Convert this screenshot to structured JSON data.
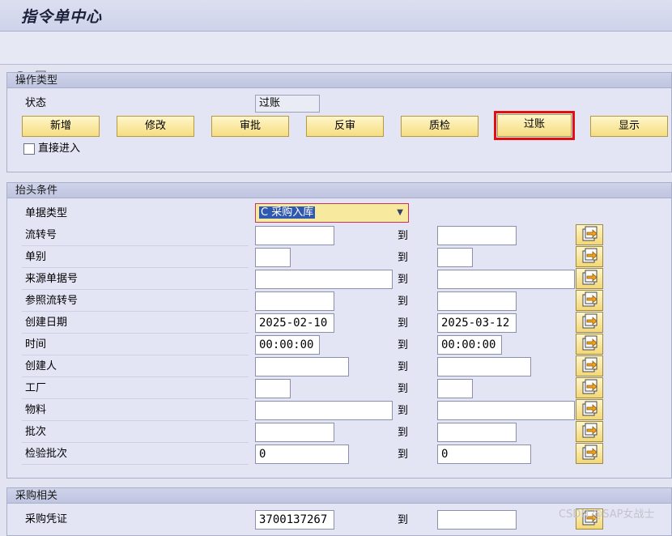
{
  "window": {
    "title": "指令单中心"
  },
  "toolbar": {
    "icons": [
      "execute-icon",
      "copy-icon"
    ]
  },
  "operation_group": {
    "header": "操作类型",
    "status_label": "状态",
    "status_value": "过账",
    "buttons": [
      "新增",
      "修改",
      "审批",
      "反审",
      "质检",
      "过账",
      "显示"
    ],
    "direct_entry_label": "直接进入",
    "direct_entry_checked": false
  },
  "header_group": {
    "header": "抬头条件",
    "doc_type_label": "单据类型",
    "doc_type_value": "C 采购入库",
    "to_label": "到",
    "rows": [
      {
        "label": "流转号",
        "from": "",
        "to": ""
      },
      {
        "label": "单别",
        "from": "",
        "to": ""
      },
      {
        "label": "来源单据号",
        "from": "",
        "to": ""
      },
      {
        "label": "参照流转号",
        "from": "",
        "to": ""
      },
      {
        "label": "创建日期",
        "from": "2025-02-10",
        "to": "2025-03-12"
      },
      {
        "label": "时间",
        "from": "00:00:00",
        "to": "00:00:00"
      },
      {
        "label": "创建人",
        "from": "",
        "to": ""
      },
      {
        "label": "工厂",
        "from": "",
        "to": ""
      },
      {
        "label": "物料",
        "from": "",
        "to": ""
      },
      {
        "label": "批次",
        "from": "",
        "to": ""
      },
      {
        "label": "检验批次",
        "from": "0",
        "to": "0"
      }
    ]
  },
  "purchase_group": {
    "header": "采购相关",
    "rows": [
      {
        "label": "采购凭证",
        "from": "3700137267",
        "to": ""
      }
    ]
  },
  "watermark": "CSDN @SAP女战士",
  "colors": {
    "highlight_box": "#e01010",
    "button_fill": "#f6dd82",
    "selection": "#2f58b0"
  }
}
